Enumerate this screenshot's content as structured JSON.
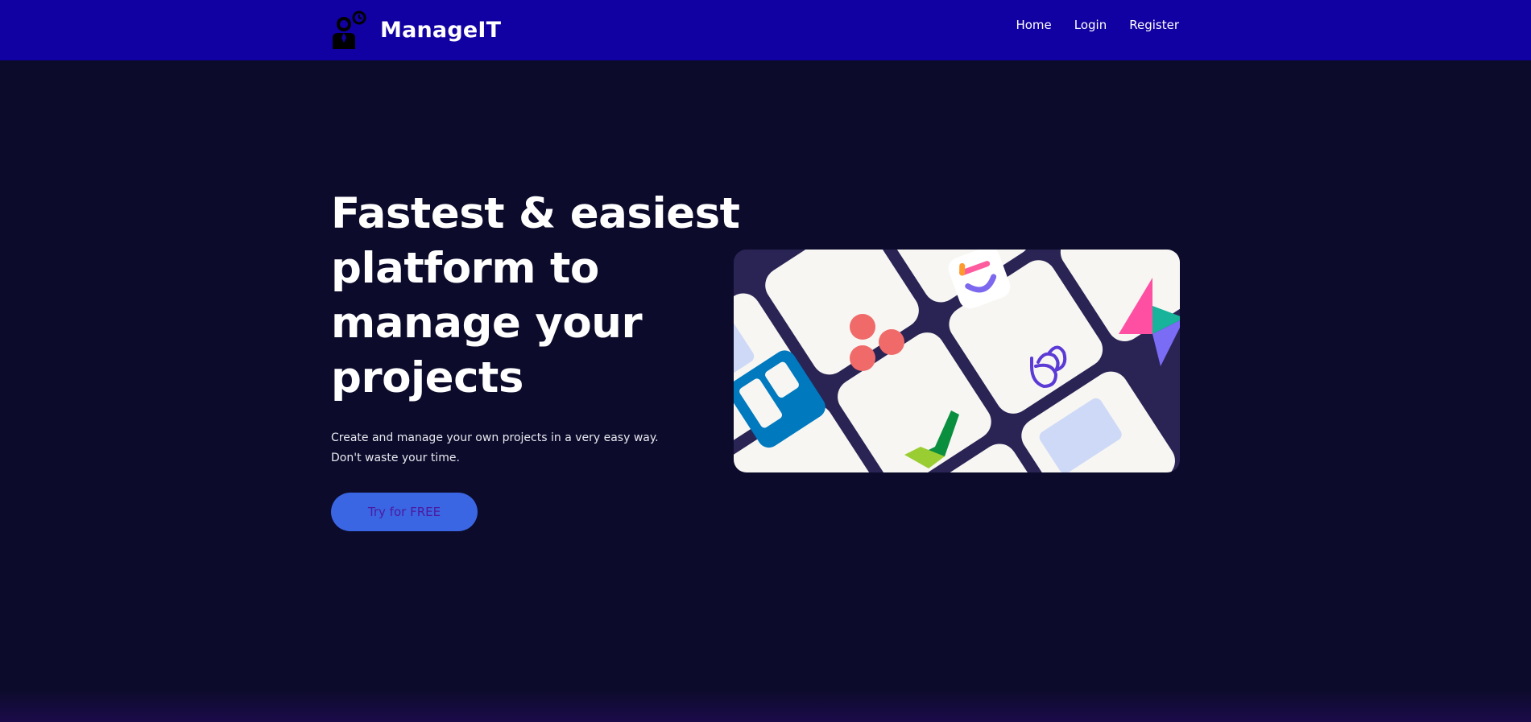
{
  "brand": {
    "name": "ManageIT",
    "logo_icon": "manager-person-icon"
  },
  "nav": {
    "items": [
      {
        "label": "Home"
      },
      {
        "label": "Login"
      },
      {
        "label": "Register"
      }
    ]
  },
  "hero": {
    "title": "Fastest & easiest platform to manage your projects",
    "subtitle_line1": "Create and manage your own projects in a very easy way.",
    "subtitle_line2": "Don't waste your time.",
    "cta_label": "Try for FREE",
    "image_icons": [
      "clickup-icon",
      "asana-icon",
      "trello-icon",
      "taskade-icon",
      "checkmark-app-icon",
      "prism-app-icon"
    ]
  },
  "colors": {
    "navbar": "#1201a2",
    "background": "#0c0b2b",
    "cta_background": "#3a66e3",
    "cta_text": "#4b1aa0"
  }
}
